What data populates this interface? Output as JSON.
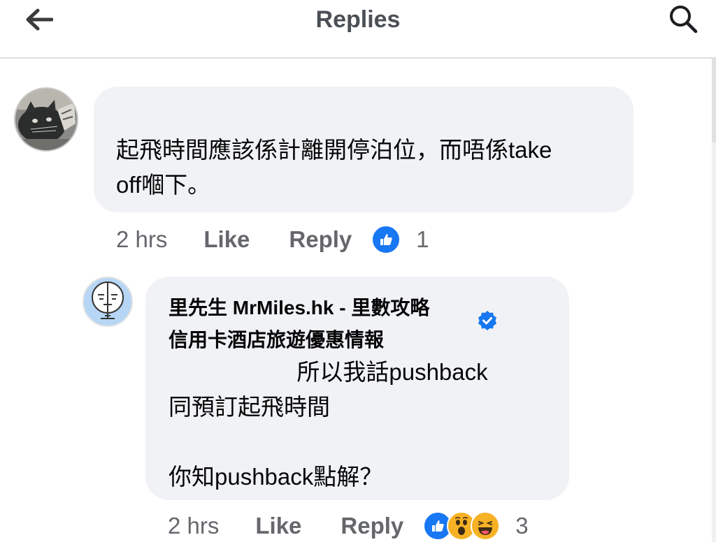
{
  "header": {
    "title": "Replies",
    "back_icon": "arrow-left-icon",
    "search_icon": "search-icon"
  },
  "comment": {
    "avatar": "user-avatar-cat",
    "text": "起飛時間應該係計離開停泊位，而唔係take\noff嗰下。",
    "time": "2 hrs",
    "like_label": "Like",
    "reply_label": "Reply",
    "reactions": [
      "like-reaction-icon"
    ],
    "reaction_count": "1"
  },
  "reply": {
    "avatar": "page-avatar-face",
    "author": "里先生 MrMiles.hk - 里數攻略\n信用卡酒店旅遊優惠情報",
    "verified_icon": "verified-badge-icon",
    "text": "                    所以我話pushback\n同預訂起飛時間\n\n你知pushback點解？",
    "time": "2 hrs",
    "like_label": "Like",
    "reply_label": "Reply",
    "reactions": [
      "like-reaction-icon",
      "wow-reaction-icon",
      "haha-reaction-icon"
    ],
    "reaction_count": "3"
  },
  "colors": {
    "bubble_bg": "#f0f2f5",
    "meta_text": "#65676b",
    "like_blue": "#1877f2",
    "reaction_yellow": "#f7b125"
  }
}
